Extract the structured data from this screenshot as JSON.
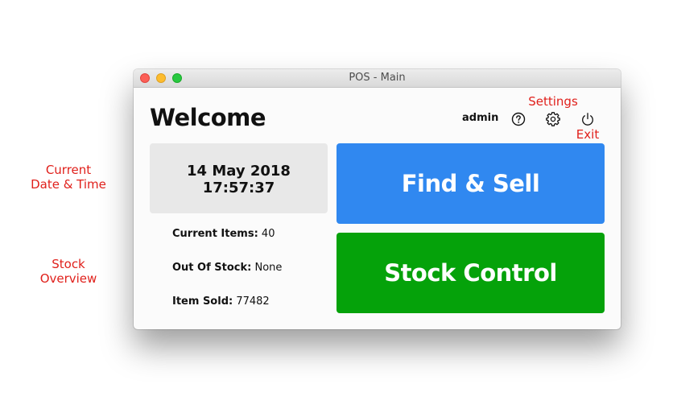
{
  "annotations": {
    "settings": "Settings",
    "exit": "Exit",
    "current_line1": "Current",
    "current_line2": "Date & Time",
    "stock_line1": "Stock",
    "stock_line2": "Overview"
  },
  "window": {
    "title": "POS - Main"
  },
  "header": {
    "welcome": "Welcome",
    "username": "admin",
    "icons": {
      "help": "help-icon",
      "settings": "gear-icon",
      "exit": "power-icon"
    }
  },
  "datetime": {
    "date": "14 May 2018",
    "time": "17:57:37"
  },
  "stock": {
    "current_items_label": "Current Items:",
    "current_items_value": "40",
    "out_of_stock_label": "Out Of Stock:",
    "out_of_stock_value": "None",
    "item_sold_label": "Item Sold:",
    "item_sold_value": "77482"
  },
  "actions": {
    "find_sell": "Find & Sell",
    "stock_control": "Stock Control"
  },
  "colors": {
    "find_sell": "#3088f0",
    "stock_control": "#05a20a",
    "annotation": "#e0201b"
  }
}
